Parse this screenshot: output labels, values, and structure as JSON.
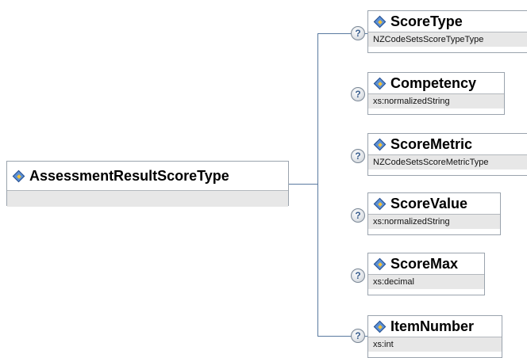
{
  "root": {
    "name": "AssessmentResultScoreType"
  },
  "help_glyph": "?",
  "children": [
    {
      "name": "ScoreType",
      "type": "NZCodeSetsScoreTypeType"
    },
    {
      "name": "Competency",
      "type": "xs:normalizedString"
    },
    {
      "name": "ScoreMetric",
      "type": "NZCodeSetsScoreMetricType"
    },
    {
      "name": "ScoreValue",
      "type": "xs:normalizedString"
    },
    {
      "name": "ScoreMax",
      "type": "xs:decimal"
    },
    {
      "name": "ItemNumber",
      "type": "xs:int"
    }
  ],
  "colors": {
    "connector": "#5a7aa0",
    "type_band": "#e7e7e7",
    "icon_blue": "#5a8fd6",
    "icon_gold": "#f2c23a"
  }
}
